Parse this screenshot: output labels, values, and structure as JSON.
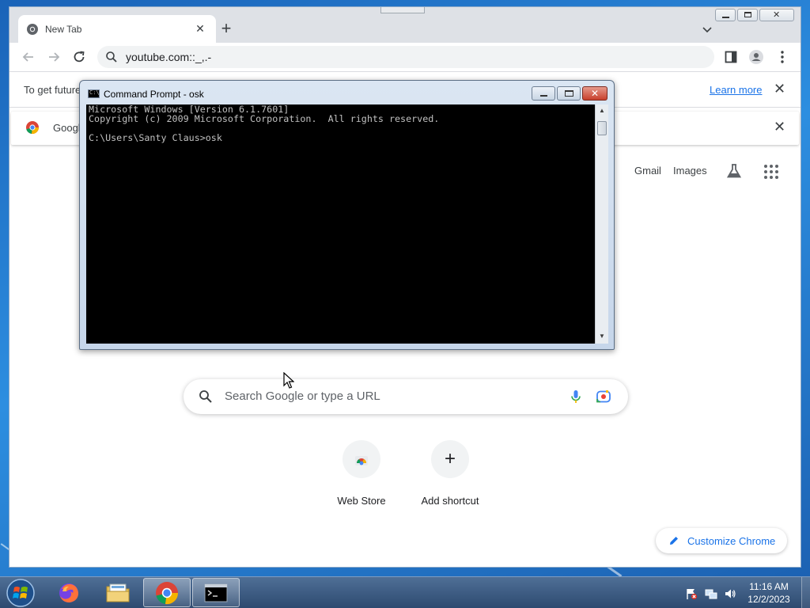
{
  "browser": {
    "tab_title": "New Tab",
    "omnibox_value": "youtube.com::_,.-",
    "infobar": {
      "text": "To get future",
      "learn_more": "Learn more"
    },
    "promo": {
      "text": "Googl"
    },
    "ntp": {
      "gmail_link": "Gmail",
      "images_link": "Images",
      "search_placeholder": "Search Google or type a URL",
      "shortcuts": [
        {
          "label": "Web Store"
        },
        {
          "label": "Add shortcut"
        }
      ],
      "customize_label": "Customize Chrome"
    }
  },
  "cmd": {
    "title": "Command Prompt - osk",
    "icon_text": "C:\\",
    "lines": [
      "Microsoft Windows [Version 6.1.7601]",
      "Copyright (c) 2009 Microsoft Corporation.  All rights reserved.",
      "",
      "C:\\Users\\Santy Claus>osk"
    ]
  },
  "taskbar": {
    "items": [
      "start-orb",
      "firefox",
      "windows-explorer",
      "google-chrome",
      "command-prompt"
    ],
    "active_item": "google-chrome",
    "clock_time": "11:16 AM",
    "clock_date": "12/2/2023"
  },
  "colors": {
    "accent_blue": "#1a73e8",
    "console_bg": "#000000",
    "console_text": "#c0c0c0",
    "taskbar": "#3a5a82"
  }
}
